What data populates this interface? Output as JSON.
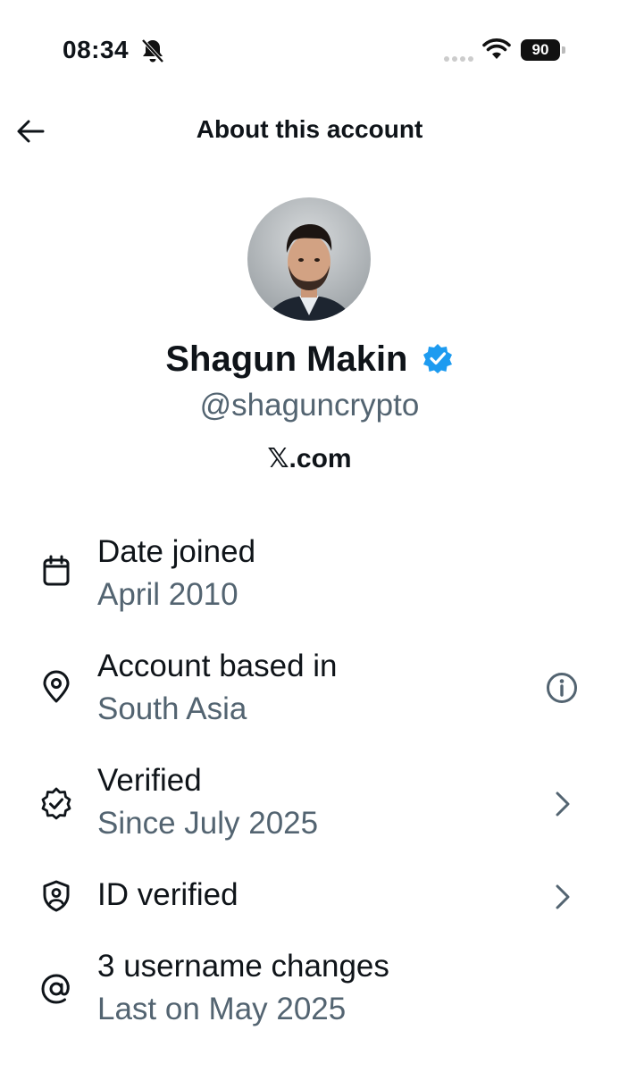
{
  "status_bar": {
    "time": "08:34",
    "battery": "90",
    "icons": [
      "bell-slash-icon",
      "signal-icon",
      "wifi-icon",
      "battery-icon"
    ]
  },
  "header": {
    "title": "About this account",
    "back_icon": "arrow-left-icon"
  },
  "profile": {
    "name": "Shagun Makin",
    "handle": "@shaguncrypto",
    "site": "𝕏.com",
    "verified_badge_color": "#1d9bf0"
  },
  "rows": [
    {
      "icon": "calendar-icon",
      "title": "Date joined",
      "subtitle": "April 2010",
      "action": ""
    },
    {
      "icon": "location-pin-icon",
      "title": "Account based in",
      "subtitle": "South Asia",
      "action": "info-icon"
    },
    {
      "icon": "verified-check-icon",
      "title": "Verified",
      "subtitle": "Since July 2025",
      "action": "chevron-right-icon"
    },
    {
      "icon": "id-shield-icon",
      "title": "ID verified",
      "subtitle": "",
      "action": "chevron-right-icon"
    },
    {
      "icon": "at-sign-icon",
      "title": "3 username changes",
      "subtitle": "Last on May 2025",
      "action": ""
    }
  ],
  "colors": {
    "text_primary": "#0f1419",
    "text_secondary": "#536471",
    "accent": "#1d9bf0"
  }
}
